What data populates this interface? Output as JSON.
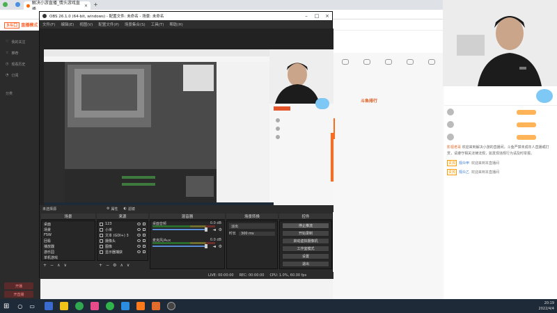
{
  "browser": {
    "tab_title": "解决小游直播_情头游戏直播",
    "new_tab": "+"
  },
  "site": {
    "logo_box": "3斗口",
    "logo_text": "直播模式"
  },
  "left_nav": {
    "items": [
      "我的关注",
      "推荐",
      "观看历史",
      "订阅"
    ],
    "section": "分类",
    "pills": [
      "开播",
      "开直播"
    ]
  },
  "obs": {
    "title": "OBS 26.1.0 (64-bit, windows) - 配置文件: 未命名 - 场景: 未命名",
    "menu": [
      "文件(F)",
      "编辑(E)",
      "视图(V)",
      "配置文件(P)",
      "场景集合(S)",
      "工具(T)",
      "帮助(H)"
    ],
    "mode_bar": {
      "label": "未选择源",
      "props": "属性",
      "filters": "滤镜"
    },
    "docks": {
      "scenes": "场景",
      "sources": "来源",
      "mixer": "混音器",
      "transitions": "场景转换",
      "controls": "控件"
    },
    "scenes": [
      "桌面",
      "场景",
      "FSW",
      "回看",
      "播放器",
      "游乐园",
      "单机游戏"
    ],
    "sources": [
      "123",
      "小米",
      "文本 (GDI+) 3",
      "摄像头",
      "图像",
      "显示器捕获"
    ],
    "mixer": [
      {
        "name": "桌面音频",
        "db": "0.0 dB"
      },
      {
        "name": "麦克风/Aux",
        "db": "0.0 dB"
      }
    ],
    "transitions": {
      "type": "淡出",
      "duration_label": "时长",
      "duration_value": "300 ms"
    },
    "controls": [
      "停止推流",
      "开始录制",
      "启动虚拟摄像机",
      "工作室模式",
      "设置",
      "退出"
    ],
    "status": {
      "live": "LIVE: 00:00:00",
      "rec": "REC: 00:00:00",
      "cpu": "CPU: 1.0%, 60.00 fps"
    }
  },
  "page": {
    "rank_banner": "斗鱼排行",
    "chat_messages": [
      {
        "name": "影视老哥",
        "text": "欢迎来到解决小游的直播间，斗鱼严禁未成年人直播或打赏，请遵守相关法律法规，如发现违规行为请及时举报。"
      }
    ],
    "chat_system": [
      {
        "tag": "贵宾",
        "name": "观众甲",
        "text": "欢迎来到本直播间"
      },
      {
        "tag": "贵宾",
        "name": "观众乙",
        "text": "欢迎来到本直播间"
      }
    ]
  },
  "taskbar": {
    "time": "20:19",
    "date": "2022/4/4"
  }
}
